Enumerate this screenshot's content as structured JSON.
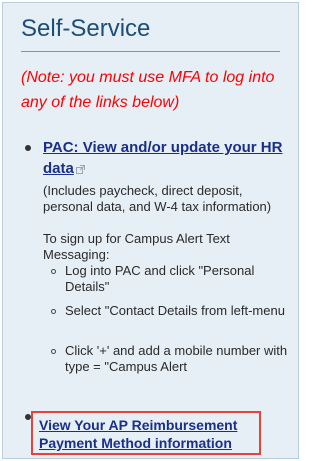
{
  "section": {
    "title": "Self-Service",
    "note": "(Note: you must use MFA to log into any of the links below)"
  },
  "pac": {
    "link_label": "PAC: View and/or update your HR data",
    "description": "(Includes paycheck, direct deposit, personal data, and W-4 tax information)",
    "signup_text": "To sign up for Campus Alert Text Messaging:",
    "steps": [
      "Log into PAC and click \"Personal Details\"",
      "Select \"Contact Details from left-menu",
      "Click '+'  and add a mobile number with type = \"Campus Alert"
    ]
  },
  "ap": {
    "link_line1": "View Your AP Reimbursement",
    "link_line2": "Payment Method information"
  },
  "colors": {
    "panel_bg": "#e6eef6",
    "title": "#1d4e78",
    "note": "#ff0000",
    "link": "#1a2f8a",
    "highlight": "#e8423a"
  },
  "icons": {
    "external": "external-link-icon"
  }
}
